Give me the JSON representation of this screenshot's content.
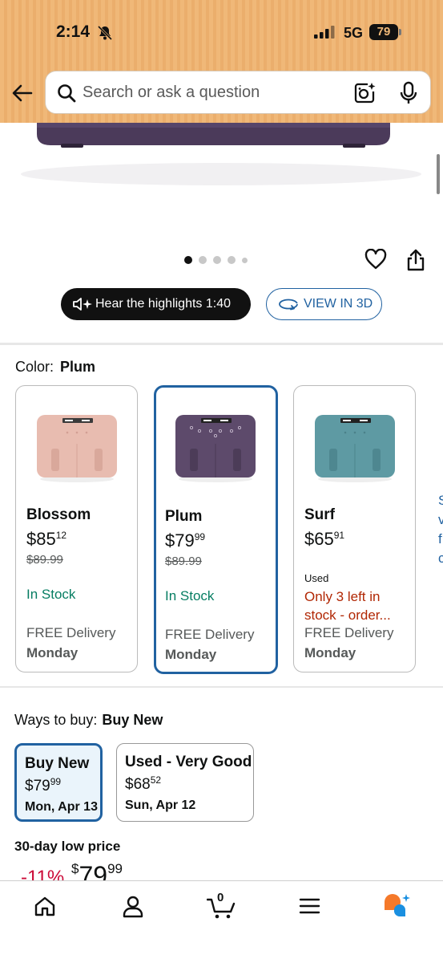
{
  "status_bar": {
    "time": "2:14",
    "network": "5G",
    "battery": "79"
  },
  "search": {
    "placeholder": "Search or ask a question"
  },
  "gallery": {
    "image_count": 5,
    "active_index": 0
  },
  "actions": {
    "hear_highlights": "Hear the highlights 1:40",
    "view_3d": "VIEW IN 3D"
  },
  "color": {
    "label": "Color:",
    "selected": "Plum",
    "options": [
      {
        "name": "Blossom",
        "price_whole": "85",
        "price_fraction": "12",
        "original_price": "$89.99",
        "condition": "",
        "availability": "In Stock",
        "delivery": "FREE Delivery",
        "delivery_day": "Monday",
        "color_hex": "#e8bcb0"
      },
      {
        "name": "Plum",
        "price_whole": "79",
        "price_fraction": "99",
        "original_price": "$89.99",
        "condition": "",
        "availability": "In Stock",
        "delivery": "FREE Delivery",
        "delivery_day": "Monday",
        "color_hex": "#5d4a6b"
      },
      {
        "name": "Surf",
        "price_whole": "65",
        "price_fraction": "91",
        "original_price": "",
        "condition": "Used",
        "availability": "Only 3 left in stock - order...",
        "delivery": "FREE Delivery",
        "delivery_day": "Monday",
        "color_hex": "#5e9aa3"
      }
    ]
  },
  "ways_to_buy": {
    "label": "Ways to buy:",
    "selected": "Buy New",
    "options": [
      {
        "title": "Buy New",
        "price_whole": "79",
        "price_fraction": "99",
        "date": "Mon, Apr 13"
      },
      {
        "title": "Used - Very Good",
        "price_whole": "68",
        "price_fraction": "52",
        "date": "Sun, Apr 12"
      }
    ]
  },
  "low_price": {
    "label": "30-day low price",
    "discount": "-11%",
    "price_whole": "79",
    "price_fraction": "99"
  },
  "bottom_nav": {
    "cart_count": "0",
    "items": [
      "home-icon",
      "account-icon",
      "cart-icon",
      "menu-icon",
      "rufus-icon"
    ]
  },
  "colors": {
    "accent_blue": "#2162a1",
    "in_stock_green": "#067d62",
    "deal_red": "#cc0c39",
    "header_orange": "#f0b878",
    "dark_button": "#111111"
  }
}
